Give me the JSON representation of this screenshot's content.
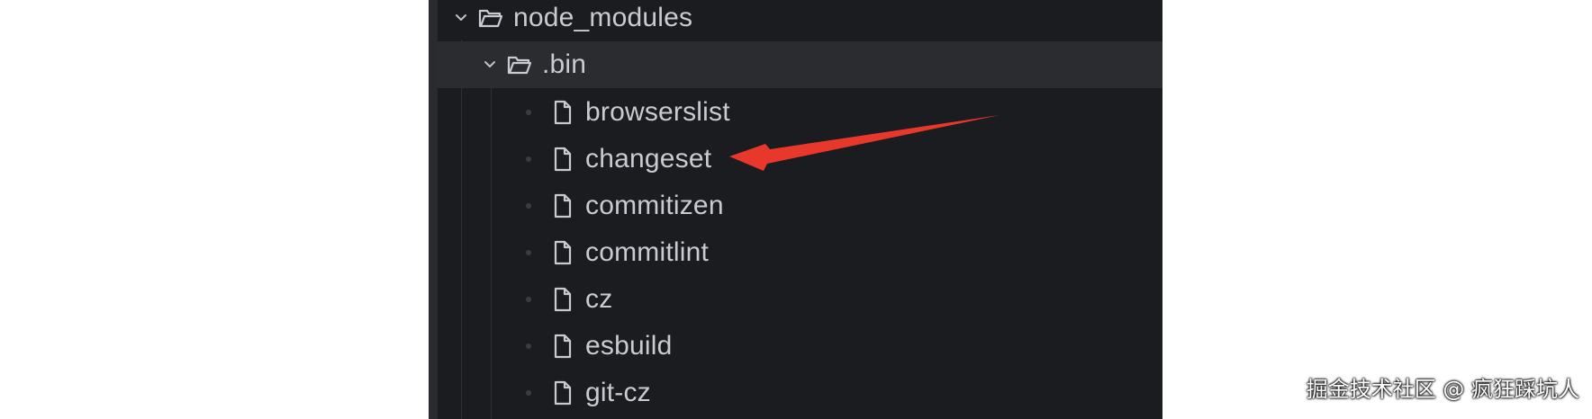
{
  "tree": {
    "root_folder": {
      "label": "node_modules",
      "expanded": true,
      "icon": "folder-open-icon"
    },
    "subfolder": {
      "label": ".bin",
      "expanded": true,
      "selected": true,
      "icon": "folder-open-icon"
    },
    "files": [
      {
        "label": "browserslist",
        "icon": "file-icon"
      },
      {
        "label": "changeset",
        "icon": "file-icon"
      },
      {
        "label": "commitizen",
        "icon": "file-icon"
      },
      {
        "label": "commitlint",
        "icon": "file-icon"
      },
      {
        "label": "cz",
        "icon": "file-icon"
      },
      {
        "label": "esbuild",
        "icon": "file-icon"
      },
      {
        "label": "git-cz",
        "icon": "file-icon"
      }
    ]
  },
  "annotation": {
    "arrow_color": "#e8382c",
    "points_to": "changeset"
  },
  "watermark": {
    "text": "掘金技术社区 @ 疯狂踩坑人"
  },
  "colors": {
    "panel_bg": "#1b1c1f",
    "selected_row_bg": "#2b2c30",
    "text": "#c8ccd2"
  }
}
